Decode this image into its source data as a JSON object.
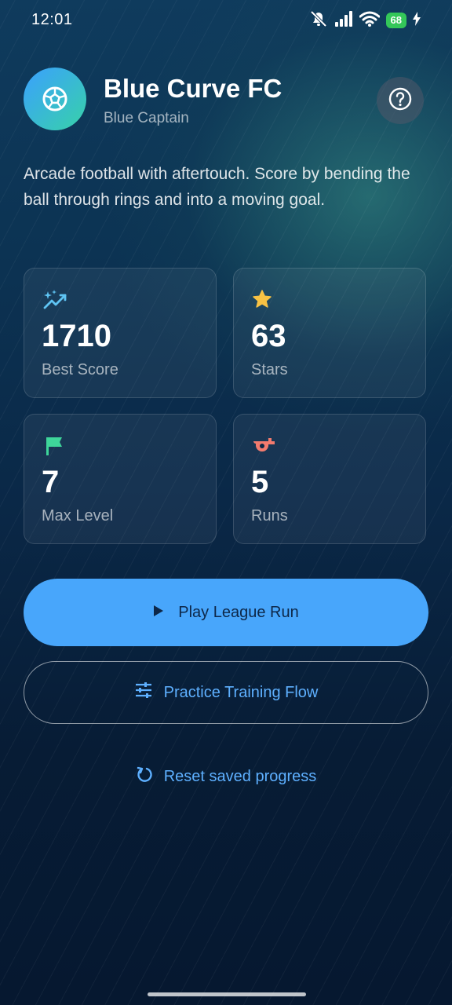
{
  "status_bar": {
    "time": "12:01",
    "battery": "68",
    "icons": [
      "mute-icon",
      "signal-icon",
      "wifi-icon",
      "battery-icon",
      "charging-icon"
    ]
  },
  "header": {
    "app_icon": "soccer-ball-icon",
    "title": "Blue Curve FC",
    "subtitle": "Blue Captain",
    "help_icon": "help-icon"
  },
  "description": "Arcade football with aftertouch. Score by bending the ball through rings and into a moving goal.",
  "stats": [
    {
      "icon": "sparkle-trend-icon",
      "icon_color": "#5fc4f3",
      "value": "1710",
      "label": "Best Score"
    },
    {
      "icon": "star-icon",
      "icon_color": "#f7c244",
      "value": "63",
      "label": "Stars"
    },
    {
      "icon": "flag-icon",
      "icon_color": "#3ed69a",
      "value": "7",
      "label": "Max Level"
    },
    {
      "icon": "whistle-icon",
      "icon_color": "#f27b6e",
      "value": "5",
      "label": "Runs"
    }
  ],
  "actions": {
    "play_label": "Play League Run",
    "practice_label": "Practice Training Flow",
    "reset_label": "Reset saved progress"
  },
  "colors": {
    "accent": "#48a6fb",
    "link": "#5eb0ff",
    "logo_gradient": [
      "#3aa0ff",
      "#38d2a8"
    ]
  }
}
